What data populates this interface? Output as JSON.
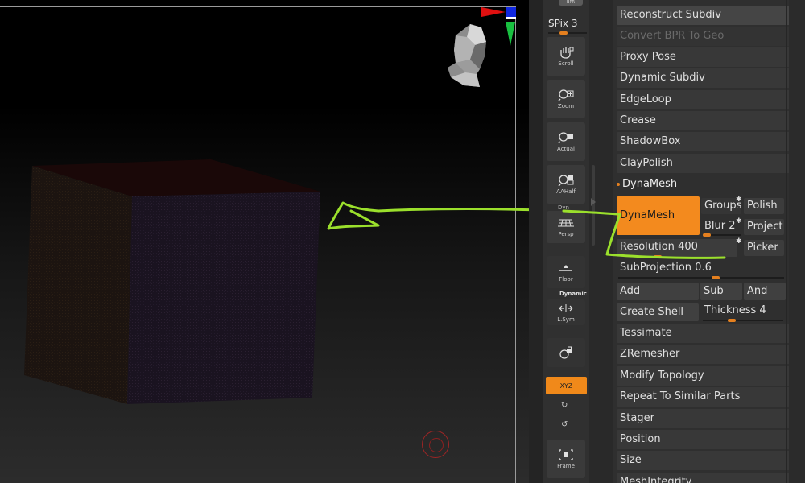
{
  "shelf": {
    "top_tab": "BPR",
    "spix_label": "SPix",
    "spix_value": "3",
    "buttons": [
      {
        "label": "Scroll",
        "icon": "hand-scroll-icon"
      },
      {
        "label": "Zoom",
        "icon": "zoom-icon"
      },
      {
        "label": "Actual",
        "icon": "actual-size-icon"
      },
      {
        "label": "AAHalf",
        "icon": "aahalf-icon"
      },
      {
        "label": "Persp",
        "icon": "perspective-grid-icon"
      },
      {
        "label": "Floor",
        "icon": "floor-icon"
      },
      {
        "label": "L.Sym",
        "icon": "local-symmetry-icon"
      },
      {
        "label": "Frame",
        "icon": "frame-icon"
      }
    ],
    "dynamic_label": "Dynamic",
    "xyz_label": "XYZ",
    "persp_sublabel": "Dyn"
  },
  "palette": {
    "items_top": [
      "Reconstruct Subdiv",
      "Convert BPR To Geo",
      "Proxy Pose",
      "Dynamic Subdiv",
      "EdgeLoop",
      "Crease",
      "ShadowBox",
      "ClayPolish"
    ],
    "section_title": "DynaMesh",
    "dynamesh_button": "DynaMesh",
    "groups": "Groups",
    "polish": "Polish",
    "blur_label": "Blur",
    "blur_value": "2",
    "project": "Project",
    "resolution_label": "Resolution",
    "resolution_value": "400",
    "picker": "Picker",
    "subprojection_label": "SubProjection",
    "subprojection_value": "0.6",
    "add": "Add",
    "sub": "Sub",
    "and": "And",
    "create_shell": "Create Shell",
    "thickness_label": "Thickness",
    "thickness_value": "4",
    "items_bottom": [
      "Tessimate",
      "ZRemesher",
      "Modify Topology",
      "Repeat To Similar Parts",
      "Stager",
      "Position",
      "Size",
      "MeshIntegrity"
    ]
  },
  "colors": {
    "accent": "#f38a1e",
    "annotation": "#9be02c",
    "axis_x": "#e01010",
    "axis_y": "#18c040",
    "axis_z": "#1028e0"
  },
  "icons": {
    "head_widget": "navigation-head-icon",
    "axis_gizmo": "axis-gizmo-icon",
    "annotation_arrow": "arrow-annotation-icon"
  }
}
